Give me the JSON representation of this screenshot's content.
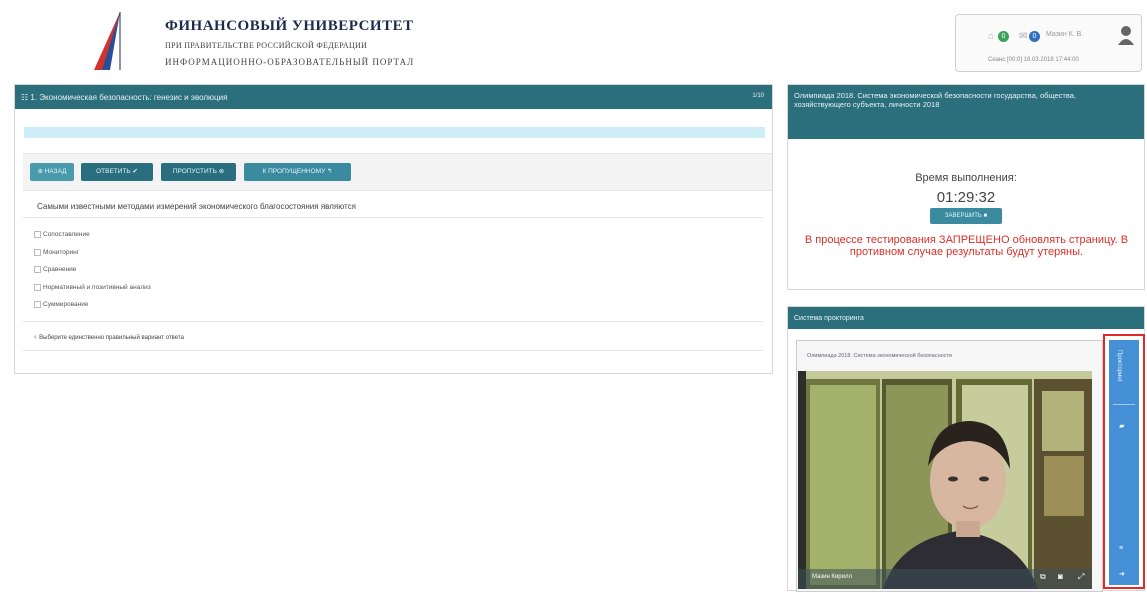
{
  "header": {
    "university_title": "ФИНАНСОВЫЙ УНИВЕРСИТЕТ",
    "university_subtitle": "ПРИ ПРАВИТЕЛЬСТВЕ РОССИЙСКОЙ ФЕДЕРАЦИИ",
    "portal_name": "ИНФОРМАЦИОННО-ОБРАЗОВАТЕЛЬНЫЙ ПОРТАЛ",
    "notifications": {
      "count_green": "0",
      "count_blue": "0"
    },
    "user_name": "Мазин К. В.",
    "status_line": "Сеанс [00:0]   18.03.2018 17:44:00"
  },
  "test": {
    "section_title": "☷ 1. Экономическая безопасность: генезис и эволюция",
    "pager": "1/10",
    "progress": 0.0,
    "buttons": {
      "back": "⊕ НАЗАД",
      "answer": "ОТВЕТИТЬ ✔",
      "skip": "ПРОПУСТИТЬ ⊗",
      "to_skipped": "К ПРОПУЩЕННОМУ ↰"
    },
    "question": "Самыми известными методами измерений экономического благосостояния являются",
    "options": [
      "Сопоставление",
      "Мониторинг",
      "Сравнение",
      "Нормативный и позитивный анализ",
      "Суммирование"
    ],
    "hint": "♀ Выберите единственно правильный вариант ответа"
  },
  "timer": {
    "olympiad_title": "Олимпиада 2018. Система экономической безопасности государства, общества, хозяйствующего субъекта, личности 2018",
    "time_label": "Время выполнения:",
    "time_value": "01:29:32",
    "finish_button": "ЗАВЕРШИТЬ ■",
    "warning": "В процессе тестирования ЗАПРЕЩЕНО обновлять страницу. В противном случае результаты будут утеряны."
  },
  "proctoring": {
    "panel_title": "Система прокторинга",
    "window_caption": "Олимпиада 2018. Система экономической безопасности",
    "video_caption": "Мазин Кирилл",
    "sidebar_label": "Прокторинг",
    "sidebar_icons": [
      "chat-icon",
      "list-icon",
      "exit-icon"
    ]
  },
  "colors": {
    "panel_header": "#2b6e7c",
    "button_teal": "#3a8ba0",
    "button_dark": "#2a6f80",
    "warning_red": "#d9302a",
    "sidebar_blue": "#4590d6",
    "sidebar_border": "#e02a2a"
  }
}
